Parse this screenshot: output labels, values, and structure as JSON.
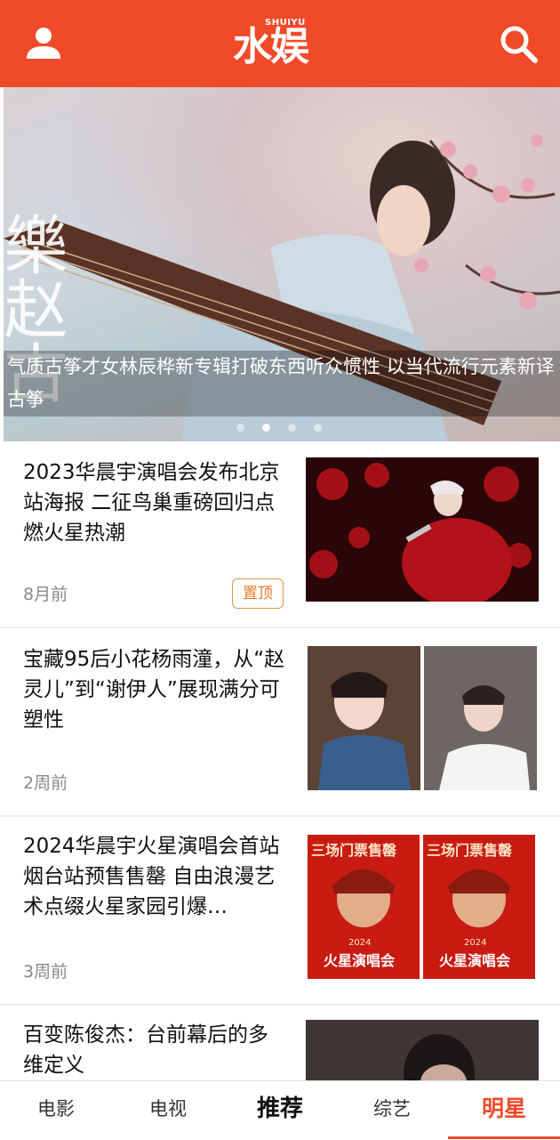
{
  "header": {
    "logo_tag": "SHUIYU",
    "logo_mark": "水娱",
    "accent_color": "#f04a2a",
    "user_icon": "user-icon",
    "search_icon": "search-icon"
  },
  "banner": {
    "caption": "气质古筝才女林辰桦新专辑打破东西听众惯性 以当代流行元素新译古筝",
    "image_text": "樂赵古",
    "slide_count": 4,
    "active_slide": 2
  },
  "news": [
    {
      "title": "2023华晨宇演唱会发布北京站海报 二征鸟巢重磅回归点燃火星热潮",
      "time": "8月前",
      "badge": "置顶"
    },
    {
      "title": "宝藏95后小花杨雨潼，从“赵灵儿”到“谢伊人”展现满分可塑性",
      "time": "2周前"
    },
    {
      "title": "2024华晨宇火星演唱会首站烟台站预售售罄 自由浪漫艺术点缀火星家园引爆…",
      "time": "3周前",
      "poster_text": "三场门票售罄",
      "poster_sub": "2024",
      "poster_title": "火星演唱会"
    },
    {
      "title": "百变陈俊杰：台前幕后的多维定义"
    }
  ],
  "tabs": [
    {
      "label": "电影"
    },
    {
      "label": "电视"
    },
    {
      "label": "推荐"
    },
    {
      "label": "综艺"
    },
    {
      "label": "明星"
    }
  ],
  "active_tab": "明星"
}
